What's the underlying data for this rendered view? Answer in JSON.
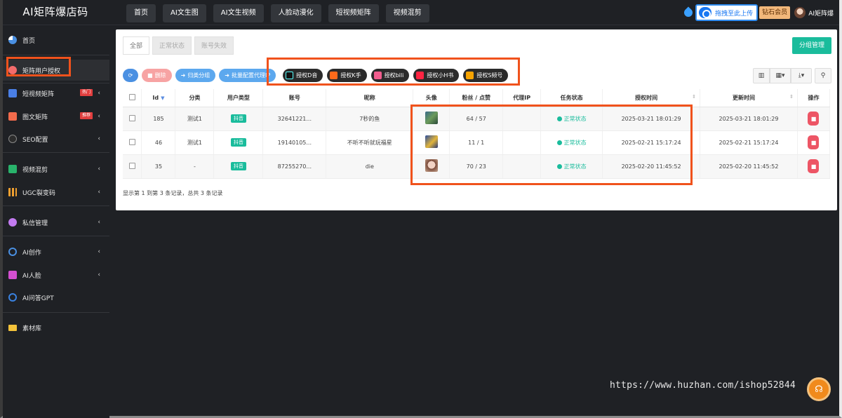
{
  "app": {
    "title": "AI矩阵爆店码"
  },
  "topnav": [
    "首页",
    "AI文生图",
    "AI文生视频",
    "人脸动漫化",
    "短视频矩阵",
    "视频混剪"
  ],
  "topright": {
    "upload_label": "拖拽至此上传",
    "vip_label": "钻石会员",
    "username": "AI矩阵爆"
  },
  "sidebar": {
    "items": [
      {
        "label": "首页"
      },
      {
        "label": "矩阵用户授权"
      },
      {
        "label": "短视频矩阵",
        "badge": "热门"
      },
      {
        "label": "图文矩阵",
        "badge": "推荐"
      },
      {
        "label": "SEO配置"
      },
      {
        "label": "视频混剪"
      },
      {
        "label": "UGC裂变码"
      },
      {
        "label": "私信管理"
      },
      {
        "label": "AI创作"
      },
      {
        "label": "AI人脸"
      },
      {
        "label": "AI问答GPT"
      },
      {
        "label": "素材库"
      }
    ]
  },
  "tabs": [
    "全部",
    "正常状态",
    "账号失效"
  ],
  "group_button": "分组管理",
  "toolbar": {
    "delete": "删除",
    "categorize": "归类分组",
    "proxy": "批量配置代理IP",
    "auth": [
      "授权D音",
      "授权K手",
      "授权bili",
      "授权小H书",
      "授权S频号"
    ]
  },
  "table": {
    "columns": [
      "Id",
      "分类",
      "用户类型",
      "账号",
      "昵称",
      "头像",
      "粉丝 / 点赞",
      "代理IP",
      "任务状态",
      "授权时间",
      "更新时间",
      "操作"
    ],
    "rows": [
      {
        "id": "185",
        "category": "测试1",
        "type": "抖音",
        "account": "32641221...",
        "nickname": "7秒的鱼",
        "fans": "64 / 57",
        "proxy": "",
        "status": "正常状态",
        "auth_time": "2025-03-21 18:01:29",
        "update_time": "2025-03-21 18:01:29"
      },
      {
        "id": "46",
        "category": "测试1",
        "type": "抖音",
        "account": "19140105...",
        "nickname": "不听不听就玩福星",
        "fans": "11 / 1",
        "proxy": "",
        "status": "正常状态",
        "auth_time": "2025-02-21 15:17:24",
        "update_time": "2025-02-21 15:17:24"
      },
      {
        "id": "35",
        "category": "-",
        "type": "抖音",
        "account": "87255270...",
        "nickname": "die",
        "fans": "70 / 23",
        "proxy": "",
        "status": "正常状态",
        "auth_time": "2025-02-20 11:45:52",
        "update_time": "2025-02-20 11:45:52"
      }
    ]
  },
  "footer_info": "显示第 1 到第 3 条记录，总共 3 条记录",
  "watermark": "https://www.huzhan.com/ishop52844",
  "colors": {
    "accent": "#1abc9c",
    "highlight": "#f0521c",
    "sidebar_bg": "#1f2125"
  }
}
